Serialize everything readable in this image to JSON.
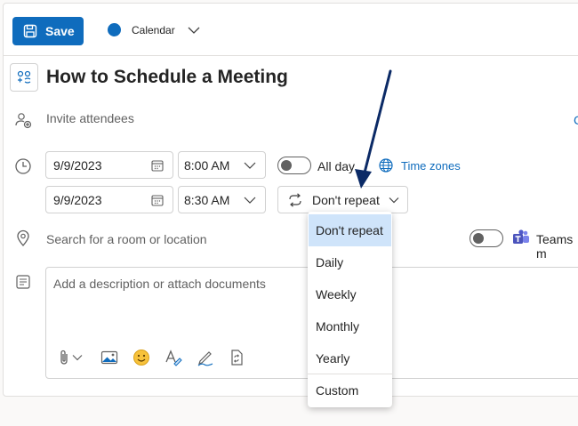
{
  "toolbar": {
    "save_label": "Save",
    "calendar_label": "Calendar",
    "calendar_color": "#0f6cbd"
  },
  "event": {
    "title": "How to Schedule a Meeting",
    "attendees_placeholder": "Invite attendees",
    "start_date": "9/9/2023",
    "start_time": "8:00 AM",
    "end_date": "9/9/2023",
    "end_time": "8:30 AM",
    "all_day_label": "All day",
    "all_day_on": false,
    "time_zones_label": "Time zones",
    "repeat_value": "Don't repeat",
    "location_placeholder": "Search for a room or location",
    "teams_label": "Teams m",
    "teams_on": false,
    "description_placeholder": "Add a description or attach documents",
    "cut_right_text": "C"
  },
  "repeat_menu": {
    "options": [
      "Don't repeat",
      "Daily",
      "Weekly",
      "Monthly",
      "Yearly",
      "Custom"
    ],
    "selected_index": 0
  },
  "icons": [
    "save-icon",
    "chevron-down-icon",
    "event-icon",
    "people-add-icon",
    "clock-icon",
    "calendar-icon",
    "globe-icon",
    "repeat-icon",
    "location-icon",
    "teams-icon",
    "notes-icon",
    "attach-icon",
    "image-icon",
    "emoji-icon",
    "format-icon",
    "signature-icon",
    "loop-icon"
  ],
  "colors": {
    "accent": "#0f6cbd",
    "selected_option": "#cfe4fa",
    "annotation_arrow": "#0b2a66"
  }
}
